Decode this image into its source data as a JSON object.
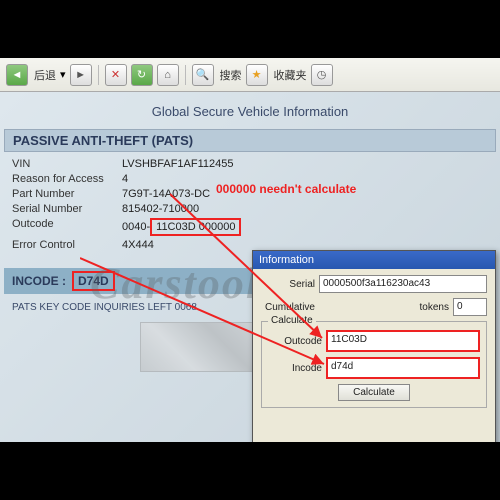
{
  "toolbar": {
    "back": "后退",
    "search": "搜索",
    "fav": "收藏夹",
    "history": "历史"
  },
  "page": {
    "title": "Global Secure Vehicle Information",
    "section": "PASSIVE ANTI-THEFT (PATS)",
    "fields": {
      "vin_label": "VIN",
      "vin": "LVSHBFAF1AF112455",
      "reason_label": "Reason for Access",
      "reason": "4",
      "part_label": "Part Number",
      "part": "7G9T-14A073-DC",
      "serial_label": "Serial Number",
      "serial": "815402-710000",
      "outcode_label": "Outcode",
      "outcode_prefix": "0040-",
      "outcode_boxed": "11C03D",
      "outcode_suffix": "000000",
      "error_label": "Error Control",
      "error": "4X444"
    },
    "incode_label": "INCODE :",
    "incode": "D74D",
    "inquiries": "PATS KEY CODE INQUIRIES LEFT 0068"
  },
  "annotation": {
    "needntcalc": "000000 needn't calculate"
  },
  "popup": {
    "title": "Information",
    "serial_label": "Serial",
    "serial": "0000500f3a116230ac43",
    "cumulative_label": "Cumulative",
    "tokens_label": "tokens",
    "tokens": "0",
    "calc_label": "Calculate",
    "outcode_label": "Outcode",
    "outcode": "11C03D",
    "incode_label": "Incode",
    "incode": "d74d",
    "btn": "Calculate"
  },
  "watermark": "Carstool"
}
